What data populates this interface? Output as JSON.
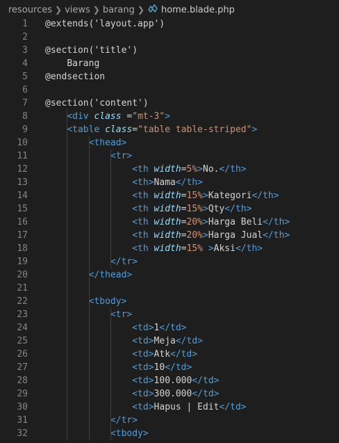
{
  "breadcrumb": {
    "parts": [
      "resources",
      "views",
      "barang"
    ],
    "file": "home.blade.php",
    "file_icon": "blade-file-icon"
  },
  "lines": [
    {
      "n": "1",
      "indent": 0,
      "tokens": [
        [
          "d",
          "@extends('layout.app')"
        ]
      ]
    },
    {
      "n": "2",
      "indent": 0,
      "tokens": []
    },
    {
      "n": "3",
      "indent": 0,
      "tokens": [
        [
          "d",
          "@section('title')"
        ]
      ]
    },
    {
      "n": "4",
      "indent": 1,
      "tokens": [
        [
          "d",
          "Barang"
        ]
      ]
    },
    {
      "n": "5",
      "indent": 0,
      "tokens": [
        [
          "d",
          "@endsection"
        ]
      ]
    },
    {
      "n": "6",
      "indent": 0,
      "tokens": []
    },
    {
      "n": "7",
      "indent": 0,
      "tokens": [
        [
          "d",
          "@section('content')"
        ]
      ]
    },
    {
      "n": "8",
      "indent": 1,
      "tokens": [
        [
          "tag",
          "<div "
        ],
        [
          "attr",
          "class"
        ],
        [
          "eq",
          " ="
        ],
        [
          "str",
          "\"mt-3\""
        ],
        [
          "tag",
          ">"
        ]
      ]
    },
    {
      "n": "9",
      "indent": 1,
      "tokens": [
        [
          "tag",
          "<table "
        ],
        [
          "attr",
          "class"
        ],
        [
          "eq",
          "="
        ],
        [
          "str",
          "\"table table-striped\""
        ],
        [
          "tag",
          ">"
        ]
      ]
    },
    {
      "n": "10",
      "indent": 2,
      "tokens": [
        [
          "tag",
          "<thead>"
        ]
      ]
    },
    {
      "n": "11",
      "indent": 3,
      "tokens": [
        [
          "tag",
          "<tr>"
        ]
      ]
    },
    {
      "n": "12",
      "indent": 4,
      "tokens": [
        [
          "tag",
          "<th "
        ],
        [
          "attr",
          "width"
        ],
        [
          "eq",
          "="
        ],
        [
          "str",
          "5%"
        ],
        [
          "tag",
          ">"
        ],
        [
          "d",
          "No."
        ],
        [
          "tag",
          "</th>"
        ]
      ]
    },
    {
      "n": "13",
      "indent": 4,
      "tokens": [
        [
          "tag",
          "<th>"
        ],
        [
          "d",
          "Nama"
        ],
        [
          "tag",
          "</th>"
        ]
      ]
    },
    {
      "n": "14",
      "indent": 4,
      "tokens": [
        [
          "tag",
          "<th "
        ],
        [
          "attr",
          "width"
        ],
        [
          "eq",
          "="
        ],
        [
          "str",
          "15%"
        ],
        [
          "tag",
          ">"
        ],
        [
          "d",
          "Kategori"
        ],
        [
          "tag",
          "</th>"
        ]
      ]
    },
    {
      "n": "15",
      "indent": 4,
      "tokens": [
        [
          "tag",
          "<th "
        ],
        [
          "attr",
          "width"
        ],
        [
          "eq",
          "="
        ],
        [
          "str",
          "15%"
        ],
        [
          "tag",
          ">"
        ],
        [
          "d",
          "Qty"
        ],
        [
          "tag",
          "</th>"
        ]
      ]
    },
    {
      "n": "16",
      "indent": 4,
      "tokens": [
        [
          "tag",
          "<th "
        ],
        [
          "attr",
          "width"
        ],
        [
          "eq",
          "="
        ],
        [
          "str",
          "20%"
        ],
        [
          "tag",
          ">"
        ],
        [
          "d",
          "Harga Beli"
        ],
        [
          "tag",
          "</th>"
        ]
      ]
    },
    {
      "n": "17",
      "indent": 4,
      "tokens": [
        [
          "tag",
          "<th "
        ],
        [
          "attr",
          "width"
        ],
        [
          "eq",
          "="
        ],
        [
          "str",
          "20%"
        ],
        [
          "tag",
          ">"
        ],
        [
          "d",
          "Harga Jual"
        ],
        [
          "tag",
          "</th>"
        ]
      ]
    },
    {
      "n": "18",
      "indent": 4,
      "tokens": [
        [
          "tag",
          "<th "
        ],
        [
          "attr",
          "width"
        ],
        [
          "eq",
          "="
        ],
        [
          "str",
          "15%"
        ],
        [
          "d",
          " "
        ],
        [
          "tag",
          ">"
        ],
        [
          "d",
          "Aksi"
        ],
        [
          "tag",
          "</th>"
        ]
      ]
    },
    {
      "n": "19",
      "indent": 3,
      "tokens": [
        [
          "tag",
          "</tr>"
        ]
      ]
    },
    {
      "n": "20",
      "indent": 2,
      "tokens": [
        [
          "tag",
          "</thead>"
        ]
      ]
    },
    {
      "n": "21",
      "indent": 0,
      "tokens": []
    },
    {
      "n": "22",
      "indent": 2,
      "tokens": [
        [
          "tag",
          "<tbody>"
        ]
      ]
    },
    {
      "n": "23",
      "indent": 3,
      "tokens": [
        [
          "tag",
          "<tr>"
        ]
      ]
    },
    {
      "n": "24",
      "indent": 4,
      "tokens": [
        [
          "tag",
          "<td>"
        ],
        [
          "d",
          "1"
        ],
        [
          "tag",
          "</td>"
        ]
      ]
    },
    {
      "n": "25",
      "indent": 4,
      "tokens": [
        [
          "tag",
          "<td>"
        ],
        [
          "d",
          "Meja"
        ],
        [
          "tag",
          "</td>"
        ]
      ]
    },
    {
      "n": "26",
      "indent": 4,
      "tokens": [
        [
          "tag",
          "<td>"
        ],
        [
          "d",
          "Atk"
        ],
        [
          "tag",
          "</td>"
        ]
      ]
    },
    {
      "n": "27",
      "indent": 4,
      "tokens": [
        [
          "tag",
          "<td>"
        ],
        [
          "d",
          "10"
        ],
        [
          "tag",
          "</td>"
        ]
      ]
    },
    {
      "n": "28",
      "indent": 4,
      "tokens": [
        [
          "tag",
          "<td>"
        ],
        [
          "d",
          "100.000"
        ],
        [
          "tag",
          "</td>"
        ]
      ]
    },
    {
      "n": "29",
      "indent": 4,
      "tokens": [
        [
          "tag",
          "<td>"
        ],
        [
          "d",
          "300.000"
        ],
        [
          "tag",
          "</td>"
        ]
      ]
    },
    {
      "n": "30",
      "indent": 4,
      "tokens": [
        [
          "tag",
          "<td>"
        ],
        [
          "d",
          "Hapus | Edit"
        ],
        [
          "tag",
          "</td>"
        ]
      ]
    },
    {
      "n": "31",
      "indent": 3,
      "tokens": [
        [
          "tag",
          "</tr>"
        ]
      ]
    },
    {
      "n": "32",
      "indent": 3,
      "tokens": [
        [
          "tag",
          "<tbody>"
        ]
      ]
    }
  ],
  "colors": {
    "background": "#1e1e1e",
    "line_number": "#858585",
    "default_text": "#d4d4d4",
    "tag": "#569cd6",
    "attribute": "#9cdcfe",
    "string": "#ce9178",
    "tab_accent": "#cca700"
  }
}
